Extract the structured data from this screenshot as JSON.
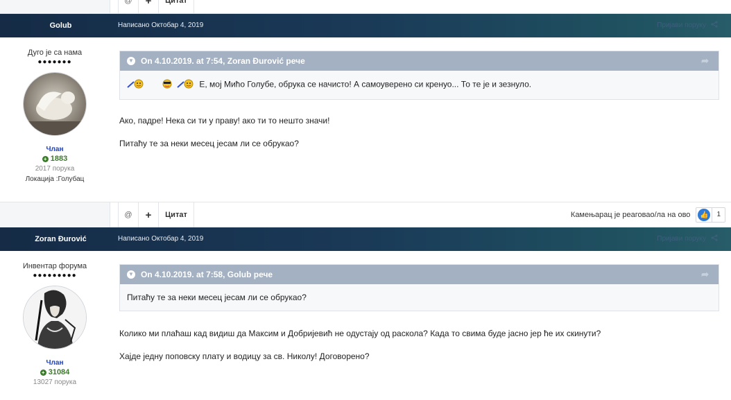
{
  "post_actions": {
    "mention_label": "@",
    "plus_label": "+",
    "quote_label": "Цитат"
  },
  "posts": [
    {
      "author": "Golub",
      "posted": "Написано Октобар 4, 2019",
      "report": "Пријави поруку",
      "rank_title": "Дуго је са нама",
      "pips": "●●●●●●●",
      "group": "Члан",
      "reputation": "1883",
      "post_count": "2017 порука",
      "location": "Локација :Голубац",
      "quote": {
        "header": "On 4.10.2019. at 7:54, Zoran Đurović рече",
        "text": "Е, мој Мићо Голубе, обрука се начисто! А самоуверено си кренуо... То те је и зезнуло."
      },
      "paragraphs": [
        "Ако, падре! Нека си ти у праву!  ако ти то нешто значи!",
        "Питаћу те за неки месец јесам ли се обрукао?"
      ],
      "reaction_text": "Камењарац је реаговао/ла на ово",
      "reaction_count": "1"
    },
    {
      "author": "Zoran Đurović",
      "posted": "Написано Октобар 4, 2019",
      "report": "Пријави поруку",
      "rank_title": "Инвентар форума",
      "pips": "●●●●●●●●●",
      "group": "Члан",
      "reputation": "31084",
      "post_count": "13027 порука",
      "quote": {
        "header": "On 4.10.2019. at 7:58, Golub рече",
        "text": "Питаћу те за неки месец јесам ли се обрукао?"
      },
      "paragraphs": [
        "Колико ми плаћаш кад видиш да Максим и Добријевић не одустају од раскола? Када то свима буде јасно јер ће их скинути?",
        "Хајде једну поповску плату и водицу за св. Николу! Договорено?"
      ]
    }
  ],
  "colors": {
    "header_gradient_start": "#152b46",
    "header_gradient_end": "#275c68",
    "quote_header": "#a3b1c2",
    "group_color": "#1b3fbf",
    "reputation_color": "#3b7a2a",
    "like_color": "#2f7bd5"
  },
  "icons": [
    "chevron-down-icon",
    "share-icon",
    "quote-arrow-icon",
    "like-icon",
    "plus-circle-icon",
    "emoji-icon"
  ]
}
